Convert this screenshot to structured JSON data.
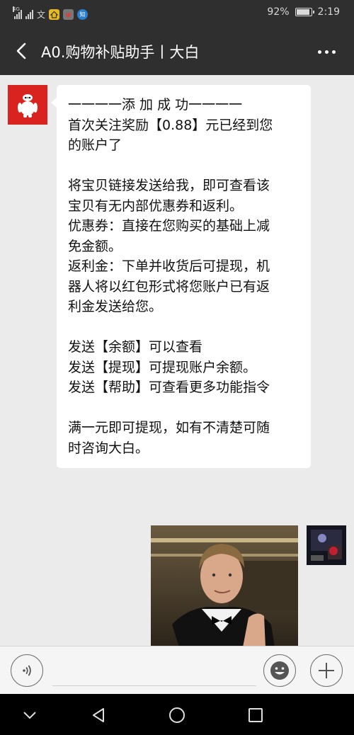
{
  "status_bar": {
    "network_tag": "4G",
    "battery_percent_label": "92%",
    "battery_level": 0.92,
    "time": "2:19",
    "notification_icons": [
      "signal-icon",
      "signal-icon",
      "text-notification-icon",
      "home-app-icon",
      "huawei-app-icon",
      "zhihu-app-icon"
    ],
    "text_icon_glyph": "文",
    "zhihu_glyph": "知"
  },
  "title_bar": {
    "title": "A0.购物补贴助手丨大白"
  },
  "message": {
    "lines": [
      "一一一一添 加 成 功一一一一",
      "首次关注奖励【0.88】元已经到您",
      "的账户了",
      "",
      "将宝贝链接发送给我，即可查看该",
      "宝贝有无内部优惠券和返利。",
      "优惠券：直接在您购买的基础上减",
      "免金额。",
      "返利金：下单并收货后可提现，机",
      "器人将以红包形式将您账户已有返",
      "利金发送给您。",
      "",
      "发送【余额】可以查看",
      "发送【提现】可提现账户余额。",
      "发送【帮助】可查看更多功能指令",
      "",
      "满一元即可提现，如有不清楚可随",
      "时咨询大白。"
    ]
  },
  "input_bar": {
    "placeholder": ""
  },
  "colors": {
    "header_bg": "#2f2f2f",
    "chat_bg": "#ebebeb",
    "bubble_bg": "#ffffff",
    "bot_avatar_bg": "#d8231f"
  }
}
